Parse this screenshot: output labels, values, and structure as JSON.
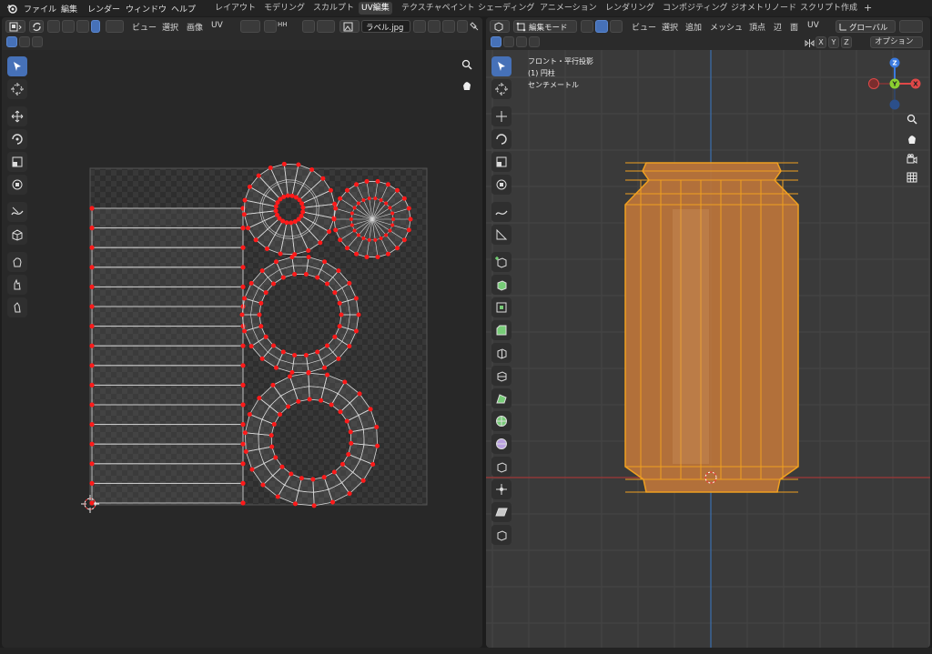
{
  "menubar": {
    "items": [
      "ファイル",
      "編集",
      "レンダー",
      "ウィンドウ",
      "ヘルプ"
    ]
  },
  "workspaces": {
    "tabs": [
      "レイアウト",
      "モデリング",
      "スカルプト",
      "UV編集",
      "テクスチャペイント",
      "シェーディング",
      "アニメーション",
      "レンダリング",
      "コンポジティング",
      "ジオメトリノード",
      "スクリプト作成"
    ],
    "active": "UV編集",
    "add": "+"
  },
  "uv_editor": {
    "menus": [
      "ビュー",
      "選択",
      "画像",
      "UV"
    ],
    "image_name": "ラベル.jpg",
    "snap_label": "HH"
  },
  "viewport": {
    "mode": "編集モード",
    "menus": [
      "ビュー",
      "選択",
      "追加",
      "メッシュ",
      "頂点",
      "辺",
      "面",
      "UV"
    ],
    "orientation": "グローバル",
    "axes": [
      "X",
      "Y",
      "Z"
    ],
    "options": "オプション",
    "overlay_lines": [
      "フロント・平行投影",
      "(1) 円柱",
      "センチメートル"
    ],
    "gizmo_labels": {
      "z": "Z",
      "y": "Y",
      "x": "X"
    }
  },
  "colors": {
    "accent_blue": "#4671b8",
    "selection_red": "#ff1a1a",
    "mesh_orange": "#f0a020",
    "mesh_fill": "#b8733a"
  }
}
